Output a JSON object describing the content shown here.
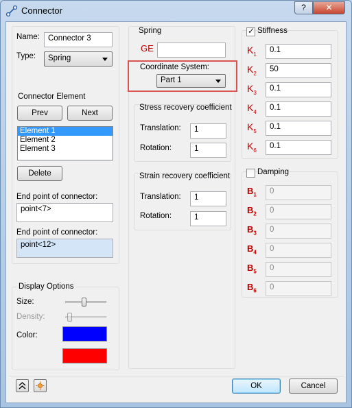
{
  "window": {
    "title": "Connector",
    "help_label": "?",
    "close_label": "✕"
  },
  "left": {
    "name_label": "Name:",
    "name_value": "Connector 3",
    "type_label": "Type:",
    "type_value": "Spring",
    "element_group_label": "Connector Element",
    "prev_label": "Prev",
    "next_label": "Next",
    "elements": [
      "Element 1",
      "Element 2",
      "Element 3"
    ],
    "delete_label": "Delete",
    "end1_label": "End point of connector:",
    "end1_value": "point<7>",
    "end2_label": "End point of connector:",
    "end2_value": "point<12>"
  },
  "display": {
    "group_label": "Display Options",
    "size_label": "Size:",
    "size_level": 0.45,
    "density_label": "Density:",
    "density_level": 0.05,
    "color_label": "Color:",
    "colors": [
      "#0000ff",
      "#ff0000"
    ]
  },
  "spring": {
    "group_label": "Spring",
    "ge_label": "GE",
    "ge_value": "",
    "coord_label": "Coordinate System:",
    "coord_value": "Part 1",
    "stress_label": "Stress recovery coefficient",
    "stress_translation_label": "Translation:",
    "stress_translation_value": "1",
    "stress_rotation_label": "Rotation:",
    "stress_rotation_value": "1",
    "strain_label": "Strain recovery coefficient",
    "strain_translation_label": "Translation:",
    "strain_translation_value": "1",
    "strain_rotation_label": "Rotation:",
    "strain_rotation_value": "1"
  },
  "stiffness": {
    "label": "Stiffness",
    "checked": true,
    "rows": [
      {
        "sym": "K",
        "sub": "1",
        "value": "0.1"
      },
      {
        "sym": "K",
        "sub": "2",
        "value": "50"
      },
      {
        "sym": "K",
        "sub": "3",
        "value": "0.1"
      },
      {
        "sym": "K",
        "sub": "4",
        "value": "0.1"
      },
      {
        "sym": "K",
        "sub": "5",
        "value": "0.1"
      },
      {
        "sym": "K",
        "sub": "6",
        "value": "0.1"
      }
    ]
  },
  "damping": {
    "label": "Damping",
    "checked": false,
    "rows": [
      {
        "sym": "B",
        "sub": "1",
        "value": "0"
      },
      {
        "sym": "B",
        "sub": "2",
        "value": "0"
      },
      {
        "sym": "B",
        "sub": "3",
        "value": "0"
      },
      {
        "sym": "B",
        "sub": "4",
        "value": "0"
      },
      {
        "sym": "B",
        "sub": "5",
        "value": "0"
      },
      {
        "sym": "B",
        "sub": "6",
        "value": "0"
      }
    ]
  },
  "footer": {
    "expand_icon": "double-chevron-up-icon",
    "pick_icon": "color-picker-icon",
    "ok_label": "OK",
    "cancel_label": "Cancel"
  }
}
